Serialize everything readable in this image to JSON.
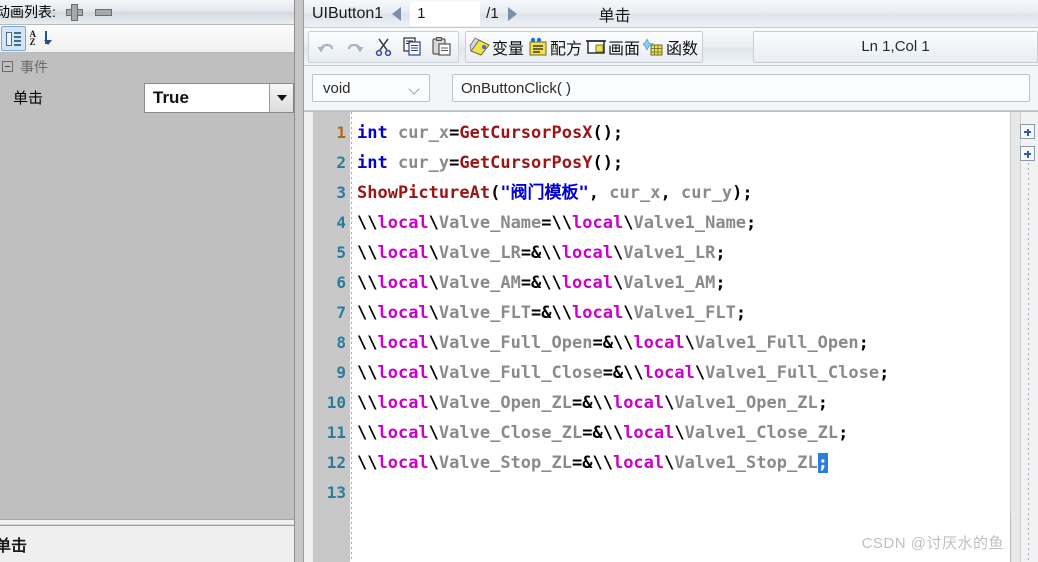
{
  "left_panel": {
    "title": "动画列表:",
    "add_button": "+",
    "remove_button": "−",
    "toolbar": {
      "categorized_icon": "categorized-view-icon",
      "sort_icon": "alphabetical-sort-icon"
    },
    "category": {
      "label": "事件",
      "expander": "collapse-icon"
    },
    "property": {
      "name": "单击",
      "value": "True",
      "dropdown_icon": "chevron-down-icon"
    },
    "description": "单击"
  },
  "editor": {
    "object_name": "UIButton1",
    "page_current": "1",
    "page_total": "/1",
    "prev_icon": "prev-arrow-icon",
    "next_icon": "next-arrow-icon",
    "event_name": "单击",
    "toolbar": {
      "undo": "undo-icon",
      "redo": "redo-icon",
      "cut": "cut-icon",
      "copy": "copy-icon",
      "paste": "paste-icon",
      "variable_label": "变量",
      "recipe_label": "配方",
      "screen_label": "画面",
      "function_label": "函数",
      "status": "Ln 1,Col 1"
    },
    "signature": {
      "return_type": "void",
      "function_name": "OnButtonClick(  )"
    },
    "code_lines": [
      {
        "n": "1",
        "current": true,
        "tokens": [
          {
            "t": "int",
            "c": "k-type"
          },
          {
            "t": " cur_x",
            "c": "k-ident"
          },
          {
            "t": "=",
            "c": "k-punct"
          },
          {
            "t": "GetCursorPosX",
            "c": "k-func"
          },
          {
            "t": "();",
            "c": "k-punct"
          }
        ]
      },
      {
        "n": "2",
        "current": false,
        "tokens": [
          {
            "t": "int",
            "c": "k-type"
          },
          {
            "t": " cur_y",
            "c": "k-ident"
          },
          {
            "t": "=",
            "c": "k-punct"
          },
          {
            "t": "GetCursorPosY",
            "c": "k-func"
          },
          {
            "t": "();",
            "c": "k-punct"
          }
        ]
      },
      {
        "n": "3",
        "current": false,
        "tokens": [
          {
            "t": "ShowPictureAt",
            "c": "k-func"
          },
          {
            "t": "(",
            "c": "k-punct"
          },
          {
            "t": "\"阀门模板\"",
            "c": "k-str"
          },
          {
            "t": ", ",
            "c": "k-punct"
          },
          {
            "t": "cur_x",
            "c": "k-ident"
          },
          {
            "t": ", ",
            "c": "k-punct"
          },
          {
            "t": "cur_y",
            "c": "k-ident"
          },
          {
            "t": ");",
            "c": "k-punct"
          }
        ]
      },
      {
        "n": "4",
        "current": false,
        "tokens": [
          {
            "t": "\\\\",
            "c": "k-punct"
          },
          {
            "t": "local",
            "c": "k-local"
          },
          {
            "t": "\\",
            "c": "k-punct"
          },
          {
            "t": "Valve_Name",
            "c": "k-ident"
          },
          {
            "t": "=",
            "c": "k-punct"
          },
          {
            "t": "\\\\",
            "c": "k-punct"
          },
          {
            "t": "local",
            "c": "k-local"
          },
          {
            "t": "\\",
            "c": "k-punct"
          },
          {
            "t": "Valve1_Name",
            "c": "k-ident"
          },
          {
            "t": ";",
            "c": "k-punct"
          }
        ]
      },
      {
        "n": "5",
        "current": false,
        "tokens": [
          {
            "t": "\\\\",
            "c": "k-punct"
          },
          {
            "t": "local",
            "c": "k-local"
          },
          {
            "t": "\\",
            "c": "k-punct"
          },
          {
            "t": "Valve_LR",
            "c": "k-ident"
          },
          {
            "t": "=&",
            "c": "k-punct"
          },
          {
            "t": "\\\\",
            "c": "k-punct"
          },
          {
            "t": "local",
            "c": "k-local"
          },
          {
            "t": "\\",
            "c": "k-punct"
          },
          {
            "t": "Valve1_LR",
            "c": "k-ident"
          },
          {
            "t": ";",
            "c": "k-punct"
          }
        ]
      },
      {
        "n": "6",
        "current": false,
        "tokens": [
          {
            "t": "\\\\",
            "c": "k-punct"
          },
          {
            "t": "local",
            "c": "k-local"
          },
          {
            "t": "\\",
            "c": "k-punct"
          },
          {
            "t": "Valve_AM",
            "c": "k-ident"
          },
          {
            "t": "=&",
            "c": "k-punct"
          },
          {
            "t": "\\\\",
            "c": "k-punct"
          },
          {
            "t": "local",
            "c": "k-local"
          },
          {
            "t": "\\",
            "c": "k-punct"
          },
          {
            "t": "Valve1_AM",
            "c": "k-ident"
          },
          {
            "t": ";",
            "c": "k-punct"
          }
        ]
      },
      {
        "n": "7",
        "current": false,
        "tokens": [
          {
            "t": "\\\\",
            "c": "k-punct"
          },
          {
            "t": "local",
            "c": "k-local"
          },
          {
            "t": "\\",
            "c": "k-punct"
          },
          {
            "t": "Valve_FLT",
            "c": "k-ident"
          },
          {
            "t": "=&",
            "c": "k-punct"
          },
          {
            "t": "\\\\",
            "c": "k-punct"
          },
          {
            "t": "local",
            "c": "k-local"
          },
          {
            "t": "\\",
            "c": "k-punct"
          },
          {
            "t": "Valve1_FLT",
            "c": "k-ident"
          },
          {
            "t": ";",
            "c": "k-punct"
          }
        ]
      },
      {
        "n": "8",
        "current": false,
        "tokens": [
          {
            "t": "\\\\",
            "c": "k-punct"
          },
          {
            "t": "local",
            "c": "k-local"
          },
          {
            "t": "\\",
            "c": "k-punct"
          },
          {
            "t": "Valve_Full_Open",
            "c": "k-ident"
          },
          {
            "t": "=&",
            "c": "k-punct"
          },
          {
            "t": "\\\\",
            "c": "k-punct"
          },
          {
            "t": "local",
            "c": "k-local"
          },
          {
            "t": "\\",
            "c": "k-punct"
          },
          {
            "t": "Valve1_Full_Open",
            "c": "k-ident"
          },
          {
            "t": ";",
            "c": "k-punct"
          }
        ]
      },
      {
        "n": "9",
        "current": false,
        "tokens": [
          {
            "t": "\\\\",
            "c": "k-punct"
          },
          {
            "t": "local",
            "c": "k-local"
          },
          {
            "t": "\\",
            "c": "k-punct"
          },
          {
            "t": "Valve_Full_Close",
            "c": "k-ident"
          },
          {
            "t": "=&",
            "c": "k-punct"
          },
          {
            "t": "\\\\",
            "c": "k-punct"
          },
          {
            "t": "local",
            "c": "k-local"
          },
          {
            "t": "\\",
            "c": "k-punct"
          },
          {
            "t": "Valve1_Full_Close",
            "c": "k-ident"
          },
          {
            "t": ";",
            "c": "k-punct"
          }
        ]
      },
      {
        "n": "10",
        "current": false,
        "tokens": [
          {
            "t": "\\\\",
            "c": "k-punct"
          },
          {
            "t": "local",
            "c": "k-local"
          },
          {
            "t": "\\",
            "c": "k-punct"
          },
          {
            "t": "Valve_Open_ZL",
            "c": "k-ident"
          },
          {
            "t": "=&",
            "c": "k-punct"
          },
          {
            "t": "\\\\",
            "c": "k-punct"
          },
          {
            "t": "local",
            "c": "k-local"
          },
          {
            "t": "\\",
            "c": "k-punct"
          },
          {
            "t": "Valve1_Open_ZL",
            "c": "k-ident"
          },
          {
            "t": ";",
            "c": "k-punct"
          }
        ]
      },
      {
        "n": "11",
        "current": false,
        "tokens": [
          {
            "t": "\\\\",
            "c": "k-punct"
          },
          {
            "t": "local",
            "c": "k-local"
          },
          {
            "t": "\\",
            "c": "k-punct"
          },
          {
            "t": "Valve_Close_ZL",
            "c": "k-ident"
          },
          {
            "t": "=&",
            "c": "k-punct"
          },
          {
            "t": "\\\\",
            "c": "k-punct"
          },
          {
            "t": "local",
            "c": "k-local"
          },
          {
            "t": "\\",
            "c": "k-punct"
          },
          {
            "t": "Valve1_Close_ZL",
            "c": "k-ident"
          },
          {
            "t": ";",
            "c": "k-punct"
          }
        ]
      },
      {
        "n": "12",
        "current": false,
        "tokens": [
          {
            "t": "\\\\",
            "c": "k-punct"
          },
          {
            "t": "local",
            "c": "k-local"
          },
          {
            "t": "\\",
            "c": "k-punct"
          },
          {
            "t": "Valve_Stop_ZL",
            "c": "k-ident"
          },
          {
            "t": "=&",
            "c": "k-punct"
          },
          {
            "t": "\\\\",
            "c": "k-punct"
          },
          {
            "t": "local",
            "c": "k-local"
          },
          {
            "t": "\\",
            "c": "k-punct"
          },
          {
            "t": "Valve1_Stop_ZL",
            "c": "k-ident"
          },
          {
            "t": ";",
            "c": "k-sel"
          }
        ]
      },
      {
        "n": "13",
        "current": false,
        "tokens": []
      }
    ]
  },
  "watermark": "CSDN @讨厌水的鱼",
  "colors": {
    "keyword_blue": "#0000d4",
    "function_red": "#9c1414",
    "local_magenta": "#cc00cc",
    "identifier_grey": "#8a8a8a",
    "selection_blue": "#2a7fde",
    "gutter_teal": "#2b7b9b",
    "gutter_current": "#b4651a",
    "property_grid_bg": "#bfbfbf"
  }
}
